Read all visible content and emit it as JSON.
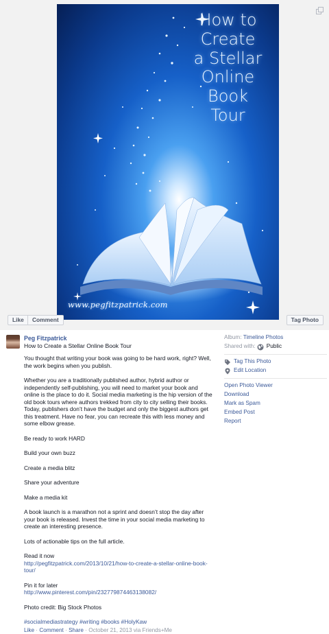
{
  "photo": {
    "title_lines": [
      "How to",
      "Create",
      "a Stellar",
      "Online",
      "Book",
      "Tour"
    ],
    "url": "www.pegfitzpatrick.com",
    "icon": "expand-icon"
  },
  "buttons": {
    "like": "Like",
    "comment": "Comment",
    "tag_photo": "Tag Photo"
  },
  "post": {
    "author": "Peg Fitzpatrick",
    "title": "How to Create a Stellar Online Book Tour",
    "paragraphs": [
      "You thought that writing your book was going to be hard work, right? Well, the work begins when you publish.",
      "Whether you are a traditionally published author, hybrid author or independently self-publishing, you will need to market your book and online is the place to do it. Social media marketing is the hip version of the old book tours where authors trekked from city to city selling their books. Today, publishers don’t have the budget and only the biggest authors get this treatment. Have no fear, you can recreate this with less money and some elbow grease.",
      "Be ready to work HARD",
      "Build your own buzz",
      "Create a media blitz",
      "Share your adventure",
      "Make a media kit",
      "A book launch is a marathon not a sprint and doesn’t stop the day after your book is released. Invest the time in your social media marketing to create an interesting presence.",
      "Lots of actionable tips on the full article."
    ],
    "read_label": "Read it now",
    "read_url": "http://pegfitzpatrick.com/2013/10/21/how-to-create-a-stellar-online-book-tour/",
    "pin_label": "Pin it for later",
    "pin_url": "http://www.pinterest.com/pin/232779874463138082/",
    "credit": "Photo credit: Big Stock Photos",
    "hashtags": [
      "#socialmediastrategy",
      "#writing",
      "#books",
      "#HolyKaw"
    ],
    "actions": {
      "like": "Like",
      "comment": "Comment",
      "share": "Share",
      "meta": "October 21, 2013 via Friends+Me",
      "sep": " · "
    }
  },
  "sidebar": {
    "album_label": "Album:",
    "album_value": "Timeline Photos",
    "shared_label": "Shared with:",
    "shared_value": "Public",
    "tag_this_photo": "Tag This Photo",
    "edit_location": "Edit Location",
    "menu": [
      "Open Photo Viewer",
      "Download",
      "Mark as Spam",
      "Embed Post",
      "Report"
    ]
  },
  "colors": {
    "link": "#3b5998",
    "muted": "#9197a3",
    "text": "#141823"
  }
}
